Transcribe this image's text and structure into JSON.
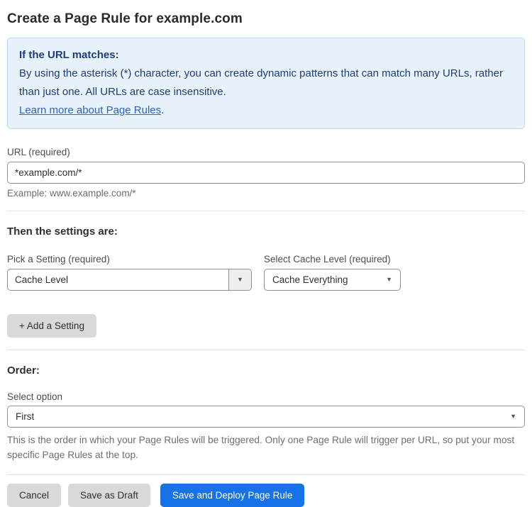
{
  "page": {
    "title": "Create a Page Rule for example.com"
  },
  "info_box": {
    "heading": "If the URL matches:",
    "body": "By using the asterisk (*) character, you can create dynamic patterns that can match many URLs, rather than just one. All URLs are case insensitive.",
    "link_label": "Learn more about Page Rules",
    "link_suffix": "."
  },
  "url_field": {
    "label": "URL (required)",
    "value": "*example.com/*",
    "helper": "Example: www.example.com/*"
  },
  "settings": {
    "heading": "Then the settings are:",
    "setting_picker": {
      "label": "Pick a Setting (required)",
      "value": "Cache Level"
    },
    "cache_level_picker": {
      "label": "Select Cache Level (required)",
      "value": "Cache Everything"
    },
    "add_button_label": "+ Add a Setting"
  },
  "order": {
    "heading": "Order:",
    "select_label": "Select option",
    "value": "First",
    "helper": "This is the order in which your Page Rules will be triggered. Only one Page Rule will trigger per URL, so put your most specific Page Rules at the top."
  },
  "actions": {
    "cancel": "Cancel",
    "save_draft": "Save as Draft",
    "save_deploy": "Save and Deploy Page Rule"
  },
  "icons": {
    "dropdown_arrow": "▼"
  },
  "colors": {
    "info_background": "#e8f2fc",
    "info_border": "#bcd8f3",
    "info_text": "#1e3c78",
    "link_blue": "#2a62c9",
    "primary_button_blue": "#1672e6",
    "gray_button": "#d9d9d9",
    "input_border": "#8f8f8f"
  }
}
